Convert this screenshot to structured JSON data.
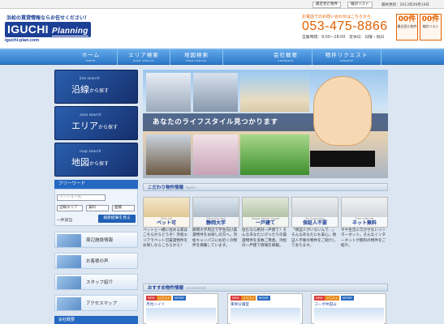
{
  "topbar": {
    "recent": "最近見た物件",
    "compare": "検討リスト",
    "update": "最終更新：2013年09月19日"
  },
  "header": {
    "tagline": "浜松の賃貸情報ならお任せください！",
    "logo_main": "IGUCHI",
    "logo_sub": "Planning",
    "domain": "iguchi-plan.com",
    "contact_label": "お電話でのお問い合わせはこちらから",
    "phone": "053-475-8866",
    "hours": "営業時間：9:00～18:00　定休日：日曜・祝日",
    "counters": [
      {
        "count": "00件",
        "label": "最近見た物件"
      },
      {
        "count": "00件",
        "label": "検討リスト"
      }
    ]
  },
  "nav": [
    {
      "label": "ホーム",
      "sub": "home"
    },
    {
      "label": "エリア検索",
      "sub": "area search"
    },
    {
      "label": "地図検索",
      "sub": "map search"
    },
    {
      "label": "会社概要",
      "sub": "company"
    },
    {
      "label": "物件リクエスト",
      "sub": "request"
    }
  ],
  "sidebar": {
    "search_buttons": [
      {
        "sub": "line search",
        "label_a": "沿線",
        "label_b": "から探す"
      },
      {
        "sub": "area search",
        "label_a": "エリア",
        "label_b": "から探す"
      },
      {
        "sub": "map search",
        "label_a": "地図",
        "label_b": "から探す"
      }
    ],
    "freeword_title": "フリーワード",
    "freeword_placeholder": "マンション名",
    "line_select": "沿線エリア",
    "price_select": "賃料",
    "layout_select": "面積",
    "by_label": "一件該当",
    "search_button": "検索結果を見る",
    "links": [
      "周辺施設情報",
      "お客様の声",
      "スタッフ紹介",
      "アクセスマップ"
    ],
    "company_label": "会社概要"
  },
  "hero": {
    "banner": "あなたのライフスタイル見つかります"
  },
  "kodawari": {
    "title": "こだわり物件情報",
    "sub": "topics",
    "cards": [
      {
        "sub": "Pets OK",
        "label": "ペット可",
        "text": "ペットと一緒に住める家はこちらからどうぞ！浜松エリアでペット可賃貸物件をお探しならこちらから！"
      },
      {
        "sub": "Shizuoka Univ",
        "label": "静岡大学",
        "text": "静岡大学周辺で学生向け賃貸物件をお探しの方へ。浜松キャンパスにお近くの物件を掲載しています。"
      },
      {
        "sub": "Single family house",
        "label": "一戸建て",
        "text": "住むなら絶対一戸建て！そんなあなたにぴったりの賃貸物件を多数ご用意。浜松の一戸建て情報を掲載。"
      },
      {
        "sub": "No Guarantor",
        "label": "保証人不要",
        "text": "「保証人がいないんで…」そんなあなたにも安心。保証人不要の物件をご紹介しております。"
      },
      {
        "sub": "Free Internet",
        "label": "ネット無料",
        "text": "今や生活に欠かせないインターネット。そんなインターネットが無料の物件をご紹介。"
      }
    ]
  },
  "recommend": {
    "title": "おすすめ物件情報",
    "sub": "recommend",
    "items": [
      {
        "name": "月見ハイツ",
        "badges": [
          "NEW",
          "オススメ",
          "MOVIE"
        ]
      },
      {
        "name": "東栄分譲室",
        "badges": [
          "NEW",
          "オススメ",
          "MOVIE"
        ]
      },
      {
        "name": "コーポ中田山",
        "badges": [
          "NEW",
          "オススメ",
          "MOVIE"
        ]
      }
    ]
  },
  "colors": {
    "brand": "#1b3f95",
    "accent": "#e26000",
    "nav": "#2c78c9"
  }
}
